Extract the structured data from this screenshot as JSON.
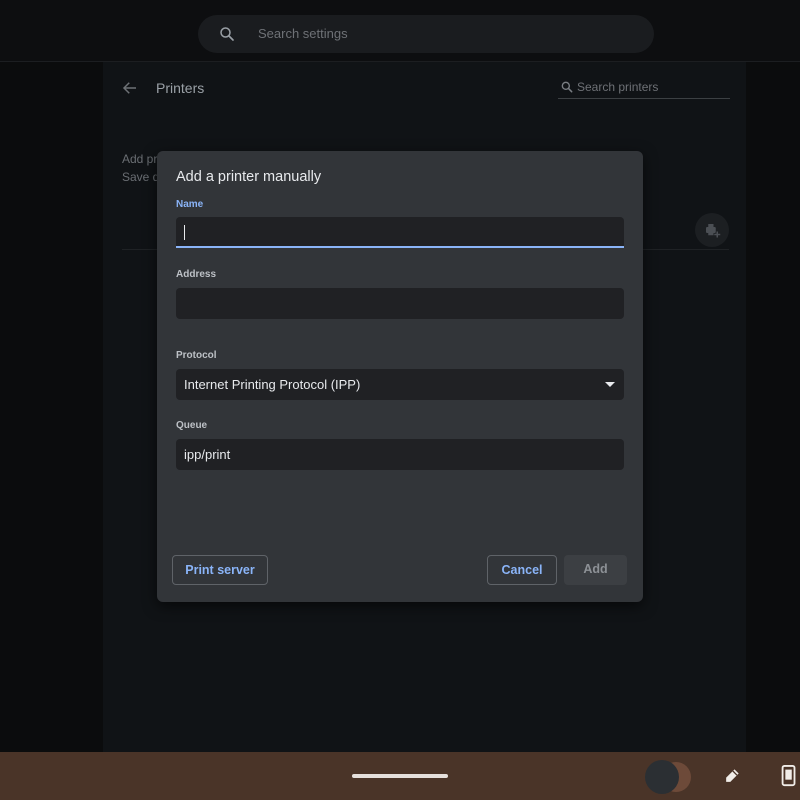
{
  "top_search": {
    "placeholder": "Search settings",
    "icon": "search-icon"
  },
  "printers_page": {
    "title": "Printers",
    "back_icon": "arrow-back-icon",
    "search_placeholder": "Search printers",
    "add_printers_text_line1": "Add printers",
    "add_printers_text_line2": "Save d",
    "add_icon": "add-printer-icon"
  },
  "dialog": {
    "title": "Add a printer manually",
    "name": {
      "label": "Name",
      "value": ""
    },
    "address": {
      "label": "Address",
      "value": ""
    },
    "protocol": {
      "label": "Protocol",
      "value": "Internet Printing Protocol (IPP)"
    },
    "queue": {
      "label": "Queue",
      "value": "ipp/print"
    },
    "buttons": {
      "print_server": "Print server",
      "cancel": "Cancel",
      "add": "Add"
    }
  },
  "shelf": {
    "icons": [
      "home-bar",
      "avatar",
      "stylus-pen-icon",
      "phone-hub-icon"
    ]
  },
  "colors": {
    "accent": "#8ab4f8",
    "dialog_bg": "#323539",
    "field_bg": "#202124",
    "shelf_bg": "#4a3428"
  }
}
